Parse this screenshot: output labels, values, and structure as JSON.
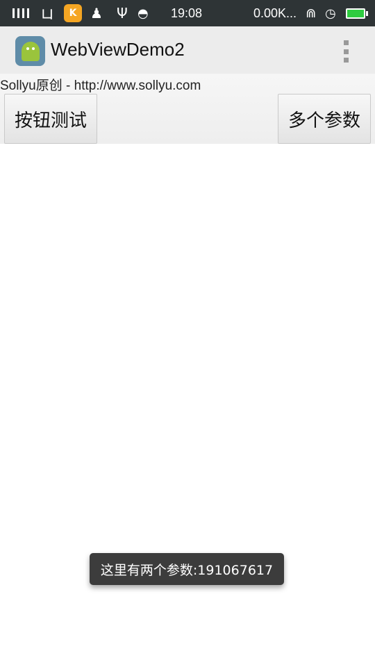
{
  "status_bar": {
    "time": "19:08",
    "net_speed": "0.00K...",
    "battery_color": "#2ecc40",
    "icons": [
      "signal-icon",
      "sim-icon",
      "kuwo-icon",
      "qq-icon",
      "usb-icon",
      "android-icon",
      "headset-icon",
      "alarm-icon",
      "battery-icon"
    ]
  },
  "action_bar": {
    "title": "WebViewDemo2",
    "app_icon": "android-app-icon",
    "overflow_icon": "overflow-menu-icon"
  },
  "web": {
    "caption": "Sollyu原创 - http://www.sollyu.com",
    "buttons": {
      "test": "按钮测试",
      "multi_params": "多个参数"
    }
  },
  "toast": {
    "message": "这里有两个参数:191067617"
  }
}
